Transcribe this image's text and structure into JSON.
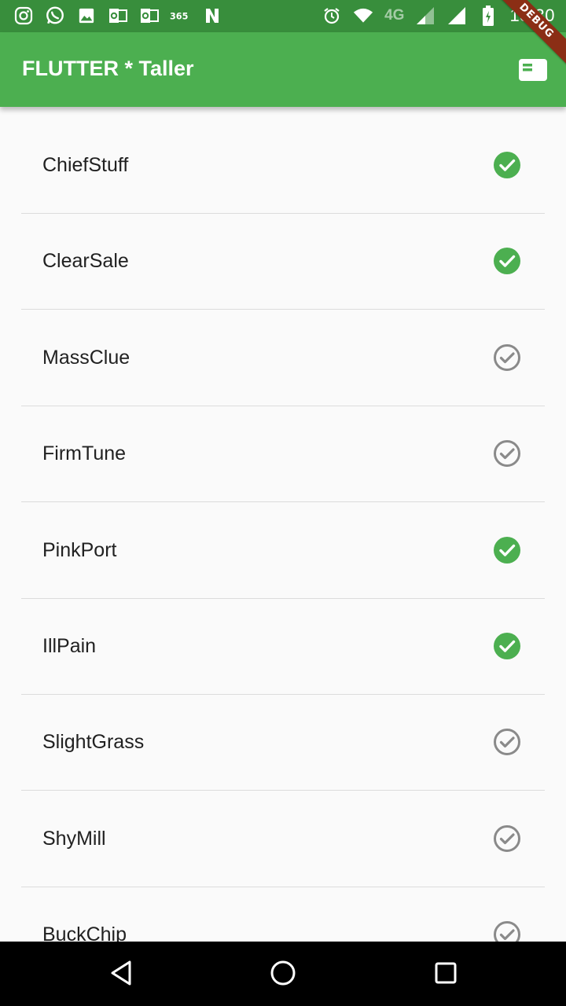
{
  "status_bar": {
    "left_icons": [
      "instagram-icon",
      "whatsapp-icon",
      "image-icon",
      "outlook-icon",
      "outlook-icon",
      "office365-icon",
      "n-icon"
    ],
    "network_label": "4G",
    "time": "13:30"
  },
  "app_bar": {
    "title": "FLUTTER * Taller",
    "action_icon": "view-agenda-icon"
  },
  "debug_banner": "DEBUG",
  "list": {
    "items": [
      {
        "label": "ChiefStuff",
        "checked": true
      },
      {
        "label": "ClearSale",
        "checked": true
      },
      {
        "label": "MassClue",
        "checked": false
      },
      {
        "label": "FirmTune",
        "checked": false
      },
      {
        "label": "PinkPort",
        "checked": true
      },
      {
        "label": "IllPain",
        "checked": true
      },
      {
        "label": "SlightGrass",
        "checked": false
      },
      {
        "label": "ShyMill",
        "checked": false
      },
      {
        "label": "BuckChip",
        "checked": false
      }
    ]
  },
  "colors": {
    "status_bar": "#388e3c",
    "app_bar": "#4caf50",
    "check_on": "#4caf50",
    "check_off": "#8a8a8a"
  },
  "nav": {
    "icons": [
      "back-icon",
      "home-icon",
      "recents-icon"
    ]
  }
}
